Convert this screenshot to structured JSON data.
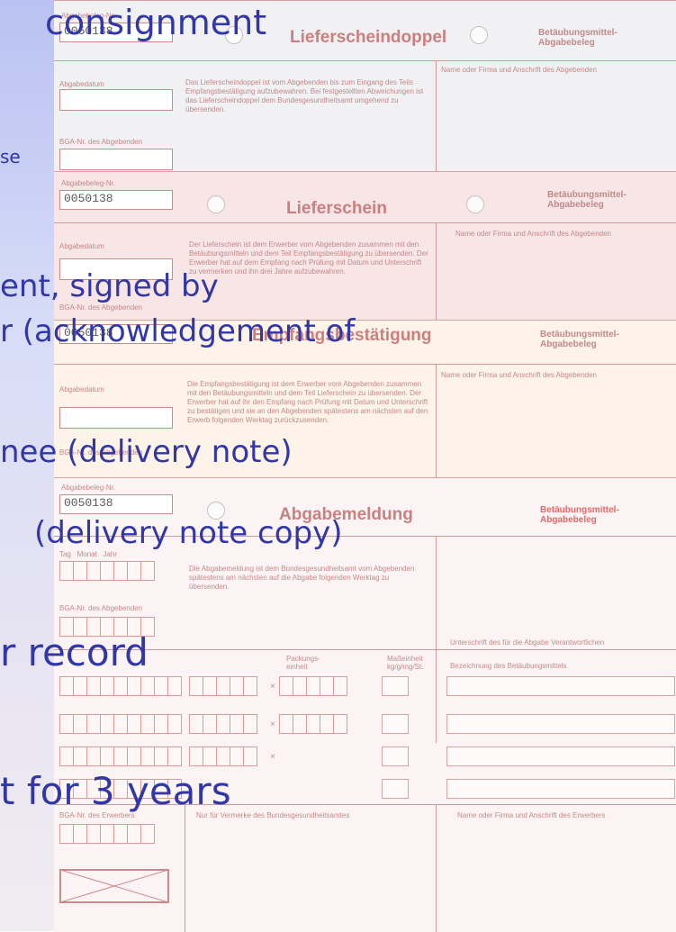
{
  "overlay": {
    "line1": "consignment",
    "line2": "se",
    "line3": "ent, signed by",
    "line4": "r (acknowledgement of",
    "line5": "nee (delivery note)",
    "line6": "(delivery note copy)",
    "line7": "r record",
    "line8": "t for 3 years"
  },
  "forms": {
    "doc_no_label": "Abgabebeleg-Nr.",
    "doc_no": "0050138",
    "date_label": "Abgabedatum",
    "bga_label": "BGA-Nr. des Abgebenden",
    "bga_buyer_label": "BGA-Nr. des Erwerbers",
    "right_title": "Betäubungsmittel-\nAbgabebeleg",
    "name_label": "Name oder Firma und Anschrift des Abgebenden",
    "name_buyer_label": "Name oder Firma und Anschrift des Erwerbers",
    "sheet1_title": "Lieferscheindoppel",
    "sheet2_title": "Lieferschein",
    "sheet3_title": "Empfangsbestätigung",
    "sheet4_title": "Abgabemeldung",
    "sheet1_text": "Das Lieferscheindoppel ist vom Abgebenden bis zum Eingang des Teils Empfangsbestätigung aufzubewahren. Bei festgestellten Abweichungen ist das Lieferscheindoppel dem Bundesgesundheitsamt umgehend zu übersenden.",
    "sheet2_text": "Der Lieferschein ist dem Erwerber vom Abgebenden zusammen mit den Betäubungsmitteln und dem Teil Empfangsbestätigung zu übersenden. Der Erwerber hat auf dem Empfang nach Prüfung mit Datum und Unterschrift zu vermerken und ihn drei Jahre aufzubewahren.",
    "sheet3_text": "Die Empfangsbestätigung ist dem Erwerber vom Abgebenden zusammen mit den Betäubungsmitteln und dem Teil Lieferschein zu übersenden. Der Erwerber hat auf ihr den Empfang nach Prüfung mit Datum und Unterschrift zu bestätigen und sie an den Abgebenden spätestens am nächsten auf den Erwerb folgenden Werktag zurückzusenden.",
    "sheet4_text": "Die Abgabemeldung ist dem Bundesgesundheitsamt vom Abgebenden spätestens am nächsten auf die Abgabe folgenden Werktag zu übersenden.",
    "date_parts": [
      "Tag",
      "Monat",
      "Jahr"
    ],
    "col_pack": "Packungs-\neinheit",
    "col_unit": "Maßeinheit\nkg/g/mg/St.",
    "col_desc": "Bezeichnung des Betäubungsmittels",
    "signature_label": "Unterschrift des für die Abgabe Verantwortlichen",
    "official_note": "Nur für Vermerke des Bundesgesundheitsamtes",
    "times": "×"
  }
}
